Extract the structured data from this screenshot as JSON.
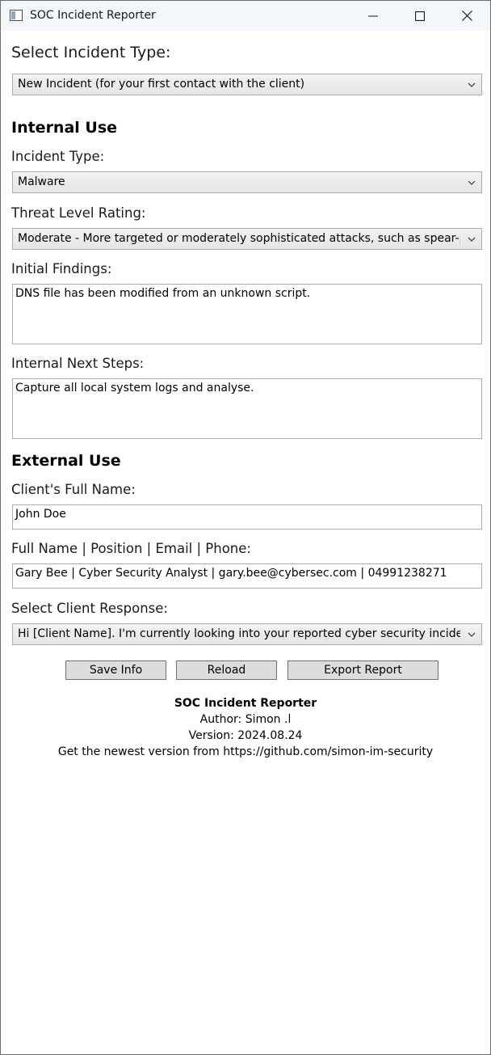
{
  "window": {
    "title": "SOC Incident Reporter",
    "controls": [
      "minimize-icon",
      "maximize-icon",
      "close-icon"
    ]
  },
  "incident_type_select": {
    "label": "Select Incident Type:",
    "value": "New Incident (for your first contact with the client)"
  },
  "internal": {
    "heading": "Internal Use",
    "incident_type": {
      "label": "Incident Type:",
      "value": "Malware"
    },
    "threat_level": {
      "label": "Threat Level Rating:",
      "value": "Moderate - More targeted or moderately sophisticated attacks, such as spear-phishing"
    },
    "initial_findings": {
      "label": "Initial Findings:",
      "value": "DNS file has been modified from an unknown script."
    },
    "next_steps": {
      "label": "Internal Next Steps:",
      "value": "Capture all local system logs and analyse."
    }
  },
  "external": {
    "heading": "External Use",
    "client_name": {
      "label": "Client's Full Name:",
      "value": "John Doe"
    },
    "signature": {
      "label": "Full Name | Position | Email | Phone:",
      "value": "Gary Bee | Cyber Security Analyst | gary.bee@cybersec.com | 04991238271"
    },
    "client_response": {
      "label": "Select Client Response:",
      "value": "Hi [Client Name]. I'm currently looking into your reported cyber security incident. C"
    }
  },
  "buttons": {
    "save": "Save Info",
    "reload": "Reload",
    "export": "Export Report"
  },
  "footer": {
    "title": "SOC Incident Reporter",
    "author": "Author: Simon .l",
    "version": "Version: 2024.08.24",
    "download": "Get the newest version from https://github.com/simon-im-security"
  }
}
